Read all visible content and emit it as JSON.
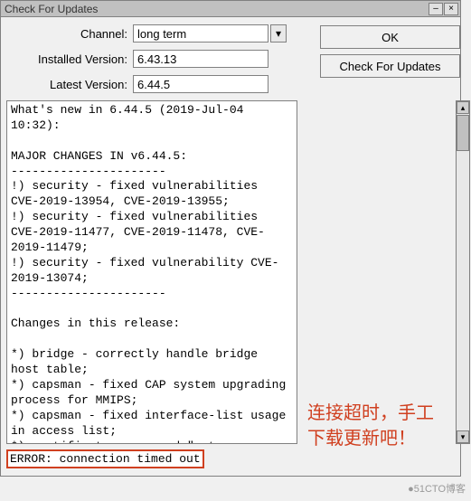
{
  "window": {
    "title": "Check For Updates",
    "minimize": "–",
    "close": "×"
  },
  "form": {
    "channel_label": "Channel:",
    "channel_value": "long term",
    "installed_label": "Installed Version:",
    "installed_value": "6.43.13",
    "latest_label": "Latest Version:",
    "latest_value": "6.44.5"
  },
  "buttons": {
    "ok": "OK",
    "check": "Check For Updates"
  },
  "changelog": "What's new in 6.44.5 (2019-Jul-04 10:32):\n\nMAJOR CHANGES IN v6.44.5:\n----------------------\n!) security - fixed vulnerabilities CVE-2019-13954, CVE-2019-13955;\n!) security - fixed vulnerabilities CVE-2019-11477, CVE-2019-11478, CVE-2019-11479;\n!) security - fixed vulnerability CVE-2019-13074;\n----------------------\n\nChanges in this release:\n\n*) bridge - correctly handle bridge host table;\n*) capsman - fixed CAP system upgrading process for MMIPS;\n*) capsman - fixed interface-list usage in access list;\n*) certificate - removed \"set-ca-passphrase\" parameter;\n*) cloud - properly stop \"time-zone",
  "error": "ERROR: connection timed out",
  "annotation": {
    "line1": "连接超时，手工",
    "line2": "下载更新吧！"
  },
  "watermark": "●51CTO博客"
}
